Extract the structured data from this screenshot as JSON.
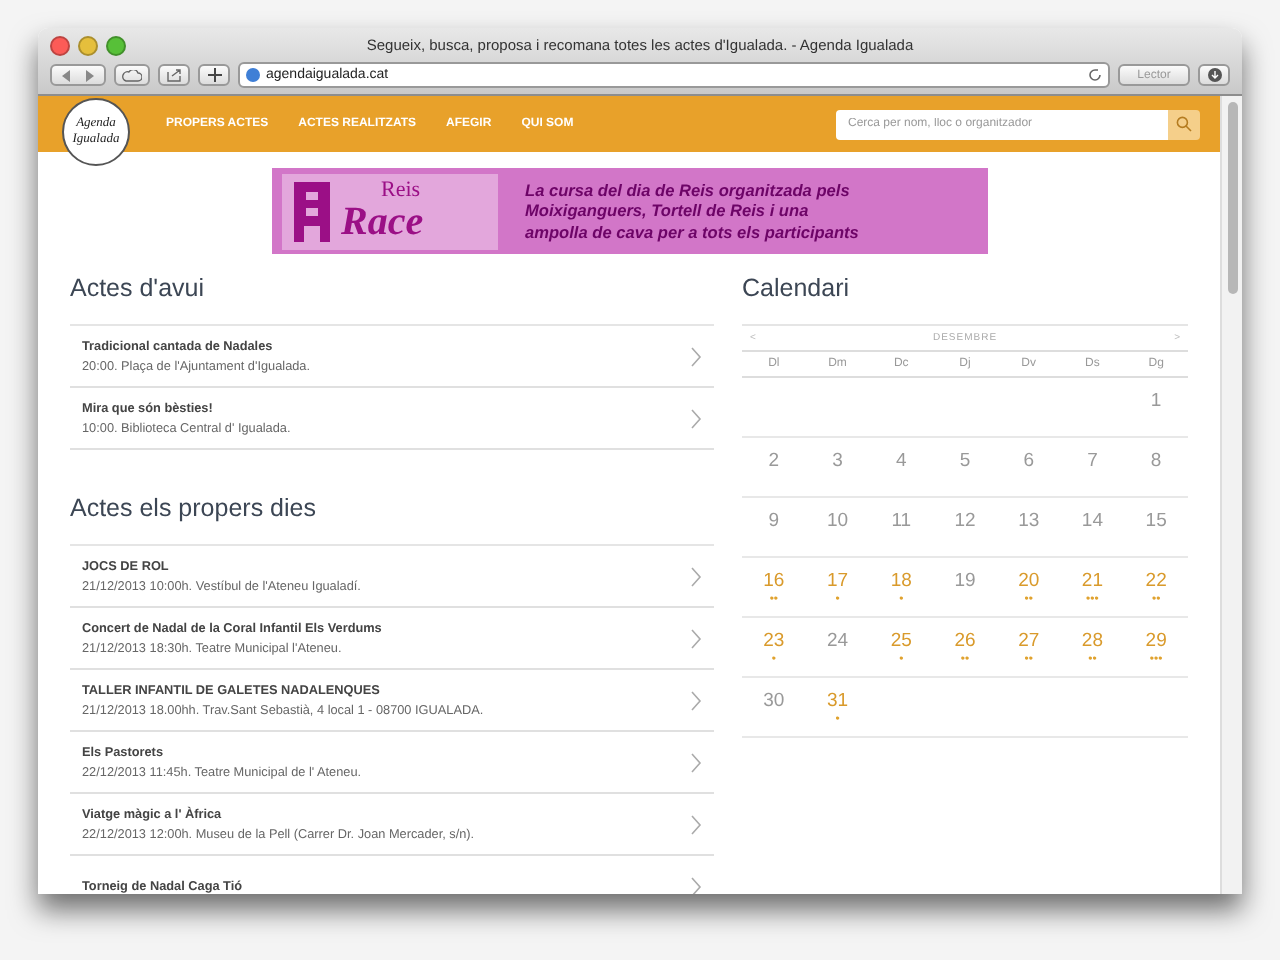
{
  "window": {
    "title": "Segueix, busca, proposa i recomana totes les actes d'Igualada. - Agenda Igualada",
    "url": "agendaigualada.cat",
    "reader": "Lector"
  },
  "header": {
    "logo_lines": [
      "Agenda",
      "Igualada"
    ],
    "nav": [
      {
        "label": "PROPERS ACTES",
        "selected": false
      },
      {
        "label": "ACTES REALITZATS",
        "selected": false
      },
      {
        "label": "AFEGIR",
        "selected": false
      },
      {
        "label": "QUI SOM",
        "selected": false
      }
    ],
    "search": {
      "placeholder": "Cerca per nom, lloc o organitzador"
    }
  },
  "banner": {
    "logo_top": "Reis",
    "logo_main": "Race",
    "text": "La cursa del dia de Reis organitzada pels Moixiganguers, Tortell de Reis i una ampolla de cava per a tots els participants"
  },
  "today": {
    "title": "Actes d'avui",
    "items": [
      {
        "name": "Tradicional cantada de Nadales",
        "when": "20:00. Plaça de l'Ajuntament d'Igualada."
      },
      {
        "name": "Mira que són bèsties!",
        "when": "10:00. Biblioteca Central d' Igualada."
      }
    ]
  },
  "upcoming": {
    "title": "Actes els propers dies",
    "items": [
      {
        "name": "JOCS DE ROL",
        "when": "21/12/2013 10:00h. Vestíbul de l'Ateneu Igualadí."
      },
      {
        "name": "Concert de Nadal de la Coral Infantil Els Verdums",
        "when": "21/12/2013 18:30h. Teatre Municipal l'Ateneu."
      },
      {
        "name": "TALLER INFANTIL DE GALETES NADALENQUES",
        "when": "21/12/2013 18.00hh. Trav.Sant Sebastià, 4 local 1 - 08700 IGUALADA."
      },
      {
        "name": "Els Pastorets",
        "when": "22/12/2013 11:45h. Teatre Municipal de l' Ateneu."
      },
      {
        "name": "Viatge màgic a l' Àfrica",
        "when": "22/12/2013 12:00h. Museu de la Pell (Carrer Dr. Joan Mercader, s/n)."
      },
      {
        "name": "Torneig de Nadal Caga Tió"
      }
    ]
  },
  "calendar": {
    "title": "Calendari",
    "month": "DESEMBRE",
    "prev": "<",
    "next": ">",
    "weekdays": [
      "Dl",
      "Dm",
      "Dc",
      "Dj",
      "Dv",
      "Ds",
      "Dg"
    ],
    "weeks": [
      [
        {
          "kind": "blank"
        },
        {
          "kind": "blank"
        },
        {
          "kind": "blank"
        },
        {
          "kind": "blank"
        },
        {
          "kind": "blank"
        },
        {
          "kind": "blank"
        },
        {
          "kind": "day",
          "day": "1",
          "has_events": false
        }
      ],
      [
        {
          "day": "2",
          "has_events": false
        },
        {
          "day": "3",
          "has_events": false
        },
        {
          "day": "4",
          "has_events": false
        },
        {
          "day": "5",
          "has_events": false
        },
        {
          "day": "6",
          "has_events": false
        },
        {
          "day": "7",
          "has_events": false
        },
        {
          "day": "8",
          "has_events": false
        }
      ],
      [
        {
          "day": "9",
          "has_events": false
        },
        {
          "day": "10",
          "has_events": false
        },
        {
          "day": "11",
          "has_events": false
        },
        {
          "day": "12",
          "has_events": false
        },
        {
          "day": "13",
          "has_events": false
        },
        {
          "day": "14",
          "has_events": false
        },
        {
          "day": "15",
          "has_events": false
        }
      ],
      [
        {
          "day": "16",
          "has_events": true,
          "dots": "••"
        },
        {
          "day": "17",
          "has_events": true,
          "dots": "•"
        },
        {
          "day": "18",
          "has_events": true,
          "dots": "•"
        },
        {
          "day": "19",
          "has_events": false
        },
        {
          "day": "20",
          "has_events": true,
          "dots": "••"
        },
        {
          "day": "21",
          "has_events": true,
          "dots": "•••"
        },
        {
          "day": "22",
          "has_events": true,
          "dots": "••"
        }
      ],
      [
        {
          "day": "23",
          "has_events": true,
          "dots": "•"
        },
        {
          "day": "24",
          "has_events": false
        },
        {
          "day": "25",
          "has_events": true,
          "dots": "•"
        },
        {
          "day": "26",
          "has_events": true,
          "dots": "••"
        },
        {
          "day": "27",
          "has_events": true,
          "dots": "••"
        },
        {
          "day": "28",
          "has_events": true,
          "dots": "••"
        },
        {
          "day": "29",
          "has_events": true,
          "dots": "•••"
        }
      ],
      [
        {
          "day": "30",
          "has_events": false
        },
        {
          "day": "31",
          "has_events": true,
          "dots": "•"
        },
        {
          "kind": "blank"
        },
        {
          "kind": "blank"
        },
        {
          "kind": "blank"
        },
        {
          "kind": "blank"
        },
        {
          "kind": "blank"
        }
      ]
    ]
  }
}
